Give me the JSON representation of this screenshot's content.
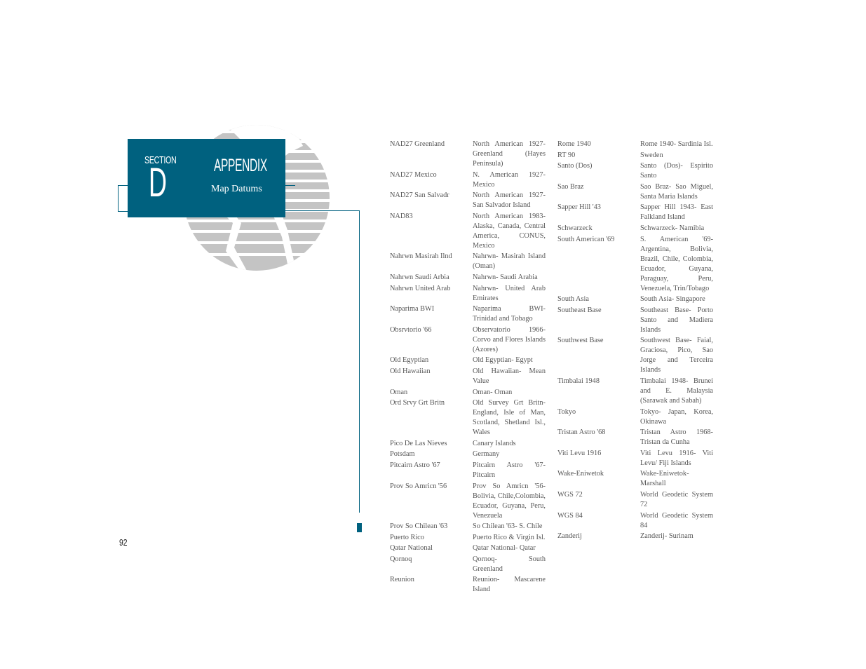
{
  "header": {
    "section_label": "SECTION",
    "section_letter": "D",
    "title": "APPENDIX",
    "subtitle": "Map Datums"
  },
  "colors": {
    "accent": "#00617f",
    "globe": "#c4c4c4",
    "text": "#555555"
  },
  "datums_left": [
    {
      "name": "NAD27 Greenland",
      "desc": "North American 1927- Greenland (Hayes Peninsula)"
    },
    {
      "name": "NAD27 Mexico",
      "desc": "N. American 1927- Mexico"
    },
    {
      "name": "NAD27 San Salvadr",
      "desc": "North American 1927- San Salvador Island"
    },
    {
      "name": "NAD83",
      "desc": "North American 1983- Alaska, Canada, Central America, CONUS, Mexico"
    },
    {
      "name": "Nahrwn Masirah Ilnd",
      "desc": "Nahrwn- Masirah Island (Oman)"
    },
    {
      "name": "Nahrwn Saudi Arbia",
      "desc": "Nahrwn- Saudi Arabia"
    },
    {
      "name": "Nahrwn United Arab",
      "desc": "Nahrwn- United Arab Emirates"
    },
    {
      "name": "Naparima BWI",
      "desc": "Naparima BWI- Trinidad and Tobago"
    },
    {
      "name": "Obsrvtorio '66",
      "desc": "Observatorio 1966- Corvo and Flores Islands (Azores)"
    },
    {
      "name": "Old Egyptian",
      "desc": "Old Egyptian- Egypt"
    },
    {
      "name": "Old Hawaiian",
      "desc": "Old Hawaiian- Mean Value"
    },
    {
      "name": "Oman",
      "desc": "Oman- Oman"
    },
    {
      "name": "Ord Srvy Grt Britn",
      "desc": "Old Survey Grt Britn- England, Isle of Man, Scotland, Shetland Isl., Wales"
    },
    {
      "name": "Pico De Las Nieves",
      "desc": "Canary Islands"
    },
    {
      "name": "Potsdam",
      "desc": "Germany"
    },
    {
      "name": "Pitcairn Astro '67",
      "desc": "Pitcairn Astro '67- Pitcairn"
    },
    {
      "name": "Prov So Amricn '56",
      "desc": "Prov So Amricn '56- Bolivia, Chile,Colombia, Ecuador, Guyana, Peru, Venezuela"
    },
    {
      "name": "Prov So Chilean '63",
      "desc": "So Chilean '63- S. Chile"
    },
    {
      "name": "Puerto Rico",
      "desc": "Puerto Rico & Virgin Isl."
    },
    {
      "name": "Qatar National",
      "desc": "Qatar National- Qatar"
    },
    {
      "name": "Qornoq",
      "desc": "Qornoq- South Greenland"
    },
    {
      "name": "Reunion",
      "desc": "Reunion- Mascarene Island"
    }
  ],
  "datums_right": [
    {
      "name": "Rome 1940",
      "desc": "Rome 1940- Sardinia Isl."
    },
    {
      "name": "RT 90",
      "desc": "Sweden"
    },
    {
      "name": "Santo (Dos)",
      "desc": "Santo (Dos)- Espirito Santo"
    },
    {
      "name": "Sao Braz",
      "desc": "Sao Braz- Sao Miguel, Santa Maria Islands"
    },
    {
      "name": "Sapper Hill '43",
      "desc": "Sapper Hill 1943- East Falkland Island"
    },
    {
      "name": "Schwarzeck",
      "desc": "Schwarzeck- Namibia"
    },
    {
      "name": "South American '69",
      "desc": "S. American '69- Argentina, Bolivia, Brazil, Chile, Colombia, Ecuador, Guyana, Paraguay, Peru, Venezuela, Trin/Tobago"
    },
    {
      "name": "South Asia",
      "desc": "South Asia- Singapore"
    },
    {
      "name": "Southeast Base",
      "desc": "Southeast Base- Porto Santo and Madiera Islands"
    },
    {
      "name": "Southwest Base",
      "desc": "Southwest Base- Faial, Graciosa, Pico, Sao Jorge and Terceira Islands"
    },
    {
      "name": "Timbalai 1948",
      "desc": "Timbalai 1948- Brunei and E. Malaysia (Sarawak and Sabah)"
    },
    {
      "name": "Tokyo",
      "desc": "Tokyo- Japan, Korea, Okinawa"
    },
    {
      "name": "Tristan Astro '68",
      "desc": "Tristan Astro 1968- Tristan da Cunha"
    },
    {
      "name": "Viti Levu 1916",
      "desc": "Viti Levu 1916- Viti Levu/ Fiji Islands"
    },
    {
      "name": "Wake-Eniwetok",
      "desc": "Wake-Eniwetok- Marshall"
    },
    {
      "name": "WGS 72",
      "desc": "World Geodetic System 72"
    },
    {
      "name": "WGS 84",
      "desc": "World Geodetic System 84"
    },
    {
      "name": "Zanderij",
      "desc": "Zanderij- Surinam"
    }
  ],
  "footer": {
    "page_number": "92"
  }
}
